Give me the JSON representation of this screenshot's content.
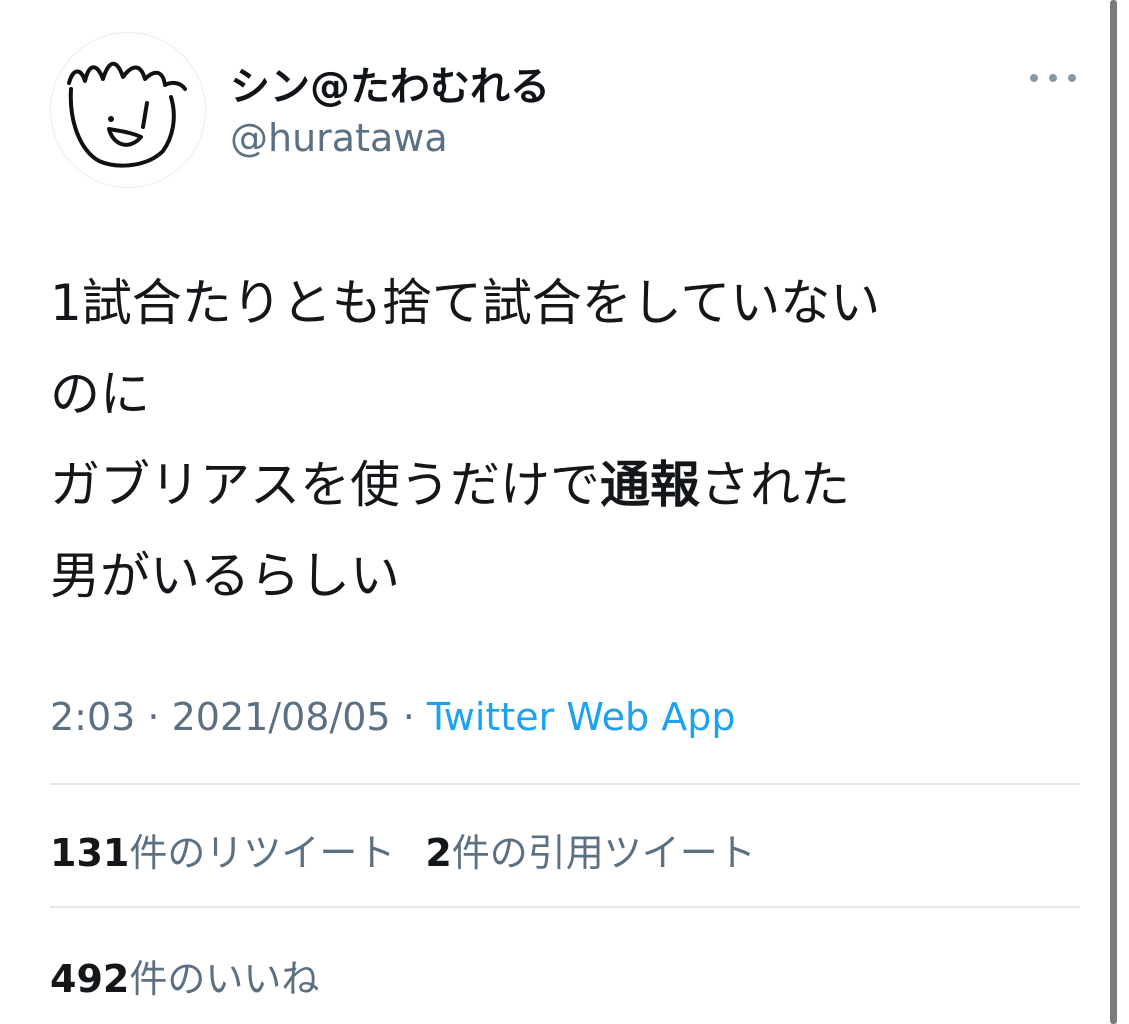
{
  "user": {
    "display_name": "シン@たわむれる",
    "handle": "@huratawa"
  },
  "tweet": {
    "line1": "1試合たりとも捨て試合をしていない",
    "line2": "のに",
    "line3_before": "ガブリアスを使うだけで",
    "line3_bold": "通報",
    "line3_after": "された",
    "line4": "男がいるらしい"
  },
  "meta": {
    "time": "2:03",
    "sep1": " · ",
    "date": "2021/08/05",
    "sep2": " · ",
    "source": "Twitter Web App"
  },
  "stats": {
    "retweets_count": "131",
    "retweets_label": "件のリツイート",
    "quotes_count": "2",
    "quotes_label": "件の引用ツイート",
    "likes_count": "492",
    "likes_label": "件のいいね"
  },
  "icons": {
    "more": "more-horizontal-icon",
    "avatar": "drawn-face-avatar"
  },
  "colors": {
    "link": "#1da1f2",
    "secondary_text": "#5b7083",
    "divider": "#e1e8ed"
  }
}
